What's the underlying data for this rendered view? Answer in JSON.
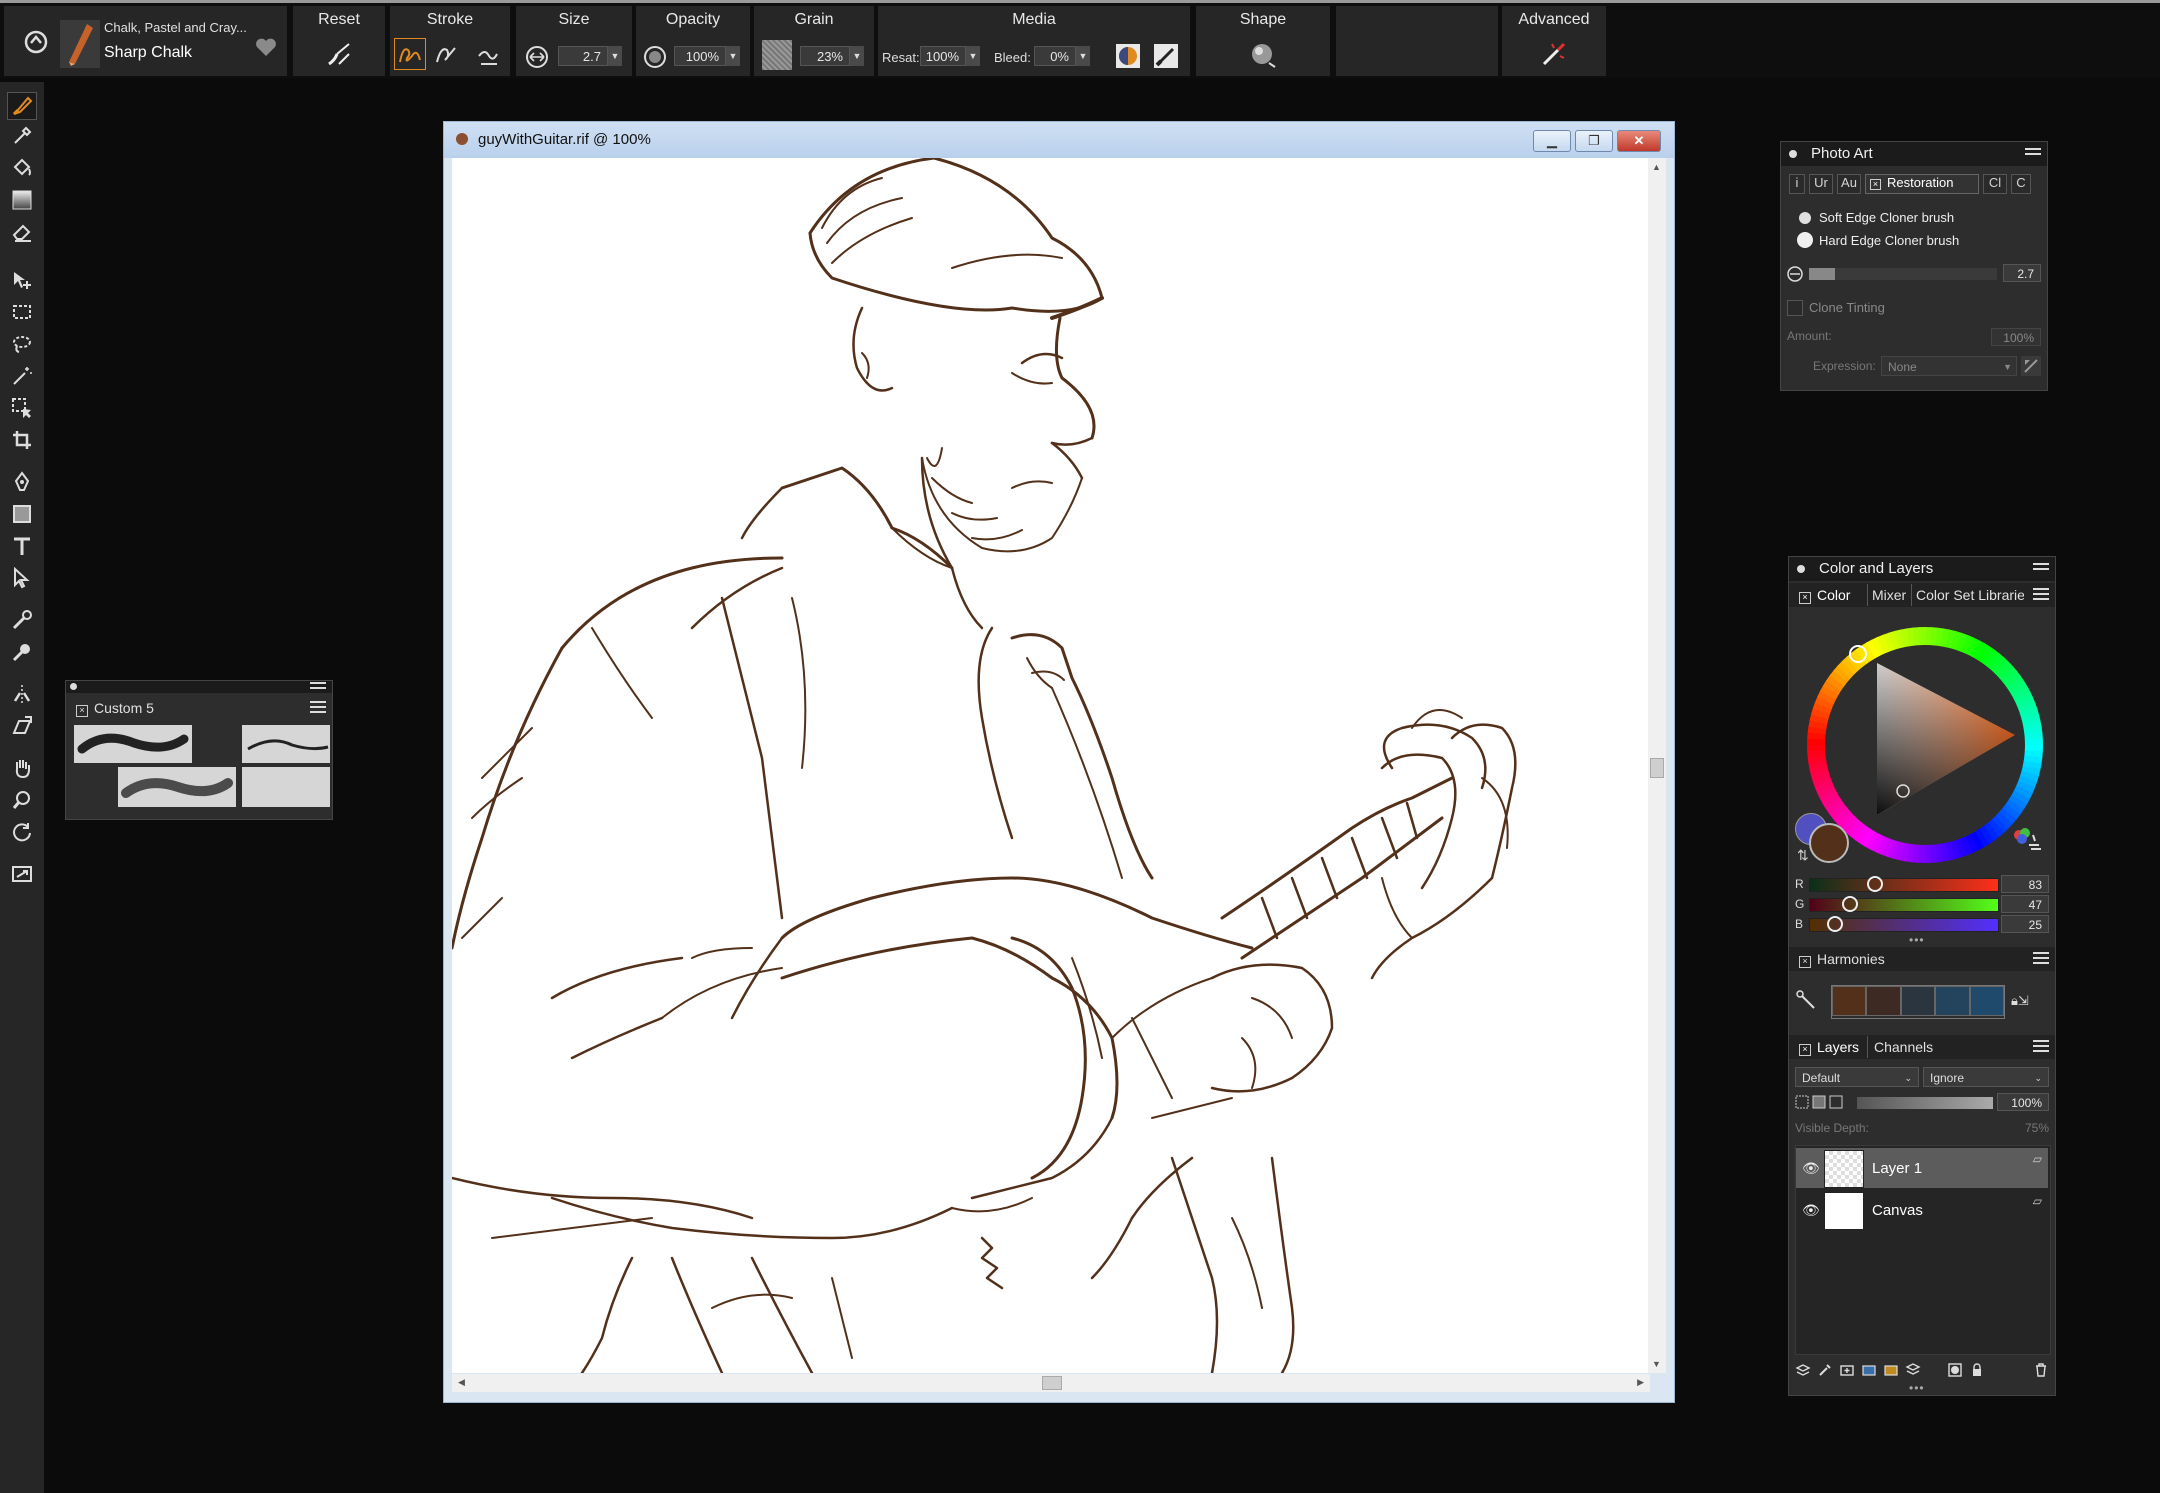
{
  "property_bar": {
    "brush_category": "Chalk, Pastel and Cray...",
    "brush_variant": "Sharp Chalk",
    "groups": {
      "reset": "Reset",
      "stroke": "Stroke",
      "size": "Size",
      "opacity": "Opacity",
      "grain": "Grain",
      "media": "Media",
      "shape": "Shape",
      "advanced": "Advanced"
    },
    "size_value": "2.7",
    "opacity_value": "100%",
    "grain_value": "23%",
    "resat_label": "Resat:",
    "resat_value": "100%",
    "bleed_label": "Bleed:",
    "bleed_value": "0%"
  },
  "custom_palette": {
    "title": "Custom 5"
  },
  "document": {
    "title": "guyWithGuitar.rif @ 100%",
    "stroke_color": "#53301a"
  },
  "photo_art": {
    "title": "Photo Art",
    "tabs": [
      "i",
      "Ur",
      "Au",
      "Restoration",
      "Cl",
      "C"
    ],
    "options": [
      "Soft Edge Cloner brush",
      "Hard Edge Cloner brush"
    ],
    "size_value": "2.7",
    "clone_tinting": "Clone Tinting",
    "amount_label": "Amount:",
    "amount_value": "100%",
    "expression_label": "Expression:",
    "expression_value": "None"
  },
  "color_layers": {
    "title": "Color and Layers",
    "color_tabs": [
      "Color",
      "Mixer",
      "Color Set Librarie"
    ],
    "main_color": "#53301a",
    "secondary_color": "#5050c0",
    "r_label": "R",
    "g_label": "G",
    "b_label": "B",
    "r_value": "83",
    "g_value": "47",
    "b_value": "25",
    "harmonies_title": "Harmonies",
    "harmony_swatches": [
      "#53301a",
      "#3d2a22",
      "#2b3540",
      "#24445e",
      "#1f4a6b"
    ],
    "layers_tab": "Layers",
    "channels_tab": "Channels",
    "composite_method": "Default",
    "composite_depth": "Ignore",
    "layer_opacity": "100%",
    "visible_depth_label": "Visible Depth:",
    "visible_depth_value": "75%",
    "layers": [
      "Layer 1",
      "Canvas"
    ]
  }
}
